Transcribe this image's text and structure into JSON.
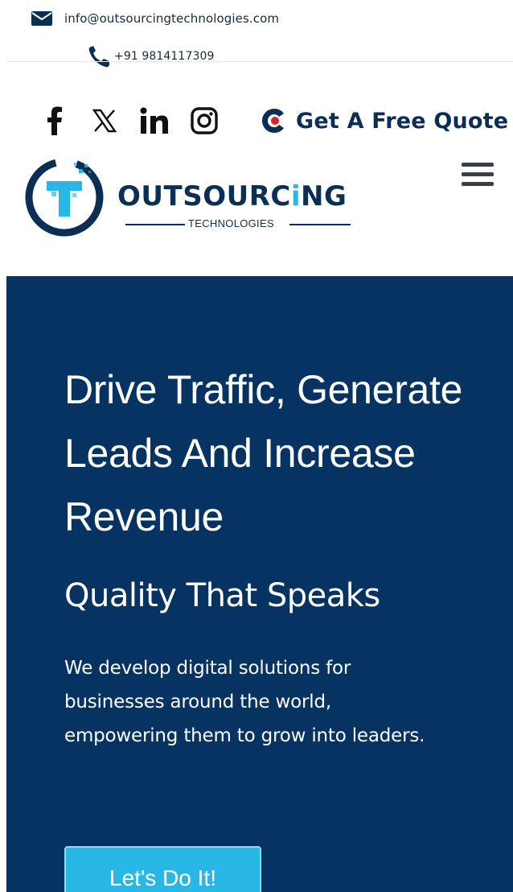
{
  "contact": {
    "email": "info@outsourcingtechnologies.com",
    "phone": "+91 9814117309"
  },
  "social": [
    "facebook-icon",
    "x-icon",
    "linkedin-icon",
    "instagram-icon"
  ],
  "quote": {
    "label": "Get A Free Quote"
  },
  "brand": {
    "name_prefix": "OUTSOURC",
    "name_suffix": "NG",
    "tagline": "TECHNOLOGIES"
  },
  "hero": {
    "headline": "Drive Traffic, Generate Leads And Increase Revenue",
    "subheadline": "Quality That Speaks",
    "body": "We develop digital solutions for businesses around the world, empowering them to grow into leaders.",
    "cta_label": "Let's Do It!"
  },
  "colors": {
    "navy": "#0b2e55",
    "hero_bg": "#063362",
    "accent_cyan": "#29b8e5",
    "accent_red": "#e0232b"
  }
}
